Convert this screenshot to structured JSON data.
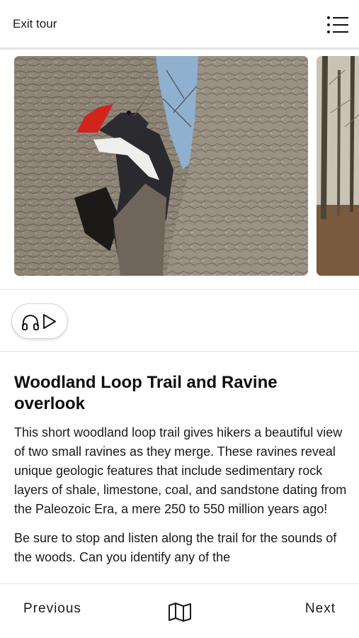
{
  "header": {
    "exit_label": "Exit tour",
    "menu_icon": "list-menu-icon"
  },
  "gallery": {
    "images": [
      {
        "alt": "pileated-woodpecker-photo"
      },
      {
        "alt": "winter-forest-photo"
      }
    ]
  },
  "audio": {
    "icons": [
      "headphones-icon",
      "play-icon"
    ]
  },
  "content": {
    "title": "Woodland Loop Trail and Ravine overlook",
    "paragraphs": [
      "This short woodland loop trail gives hikers a beautiful view of two small ravines as they merge. These ravines reveal unique geologic features that include sedimentary rock layers of shale, limestone, coal, and sandstone dating from the Paleozoic Era, a mere 250 to 550 million years ago!",
      "Be sure to stop and listen along the trail for the sounds of the woods. Can you identify any of the"
    ]
  },
  "footer": {
    "previous_label": "Previous",
    "next_label": "Next",
    "map_icon": "map-icon"
  }
}
